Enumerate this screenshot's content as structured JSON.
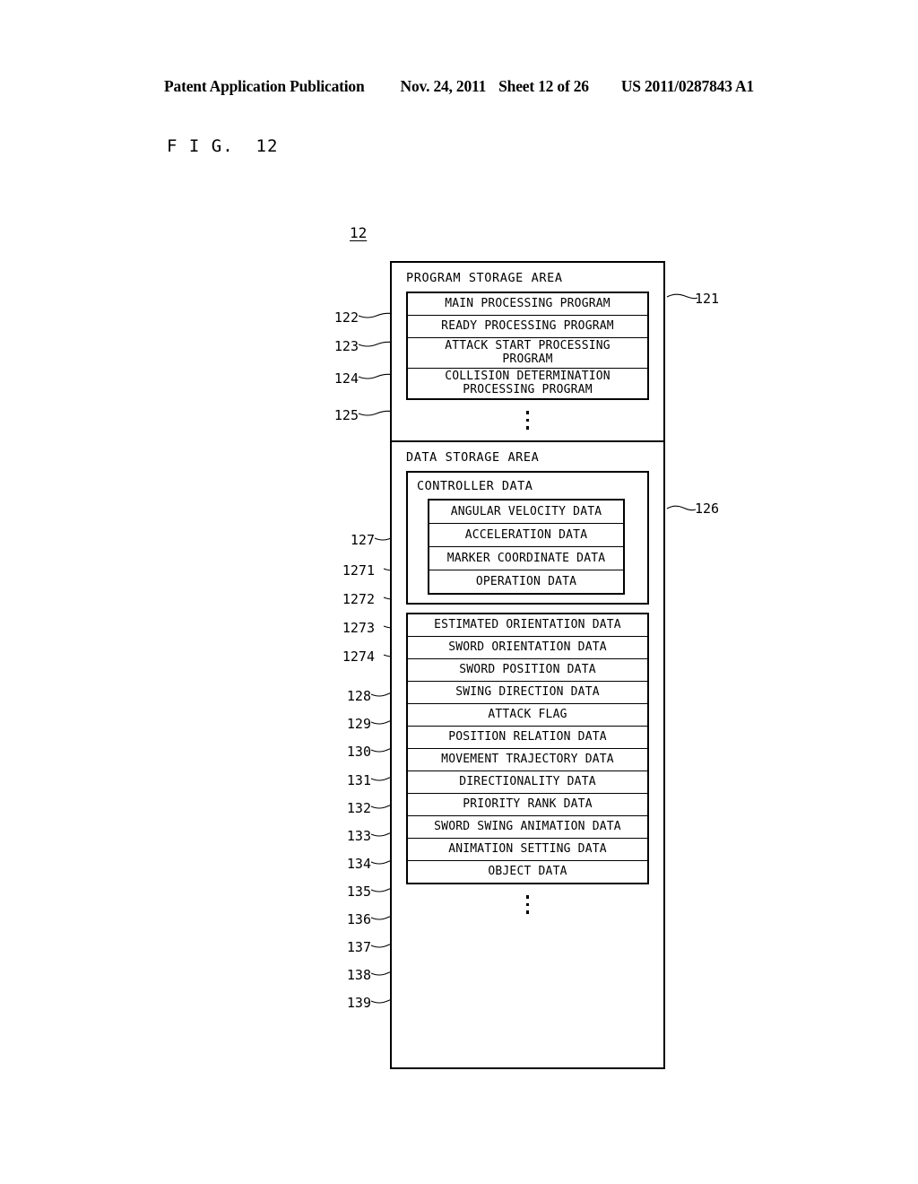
{
  "header": {
    "publication": "Patent Application Publication",
    "date": "Nov. 24, 2011",
    "sheet": "Sheet 12 of 26",
    "patent_number": "US 2011/0287843 A1"
  },
  "figure": {
    "caption": "F I G.  12",
    "top_ref": "12"
  },
  "diagram": {
    "program_area": {
      "title": "PROGRAM STORAGE AREA",
      "ref": "121",
      "items": [
        {
          "ref": "122",
          "label": "MAIN PROCESSING PROGRAM"
        },
        {
          "ref": "123",
          "label": "READY PROCESSING PROGRAM"
        },
        {
          "ref": "124",
          "label_line1": "ATTACK START PROCESSING",
          "label_line2": "PROGRAM"
        },
        {
          "ref": "125",
          "label_line1": "COLLISION DETERMINATION",
          "label_line2": "PROCESSING PROGRAM"
        }
      ]
    },
    "data_area": {
      "title": "DATA STORAGE AREA",
      "ref": "126",
      "controller_data": {
        "ref": "127",
        "title": "CONTROLLER DATA",
        "items": [
          {
            "ref": "1271",
            "label": "ANGULAR VELOCITY DATA"
          },
          {
            "ref": "1272",
            "label": "ACCELERATION DATA"
          },
          {
            "ref": "1273",
            "label": "MARKER COORDINATE DATA"
          },
          {
            "ref": "1274",
            "label": "OPERATION DATA"
          }
        ]
      },
      "items": [
        {
          "ref": "128",
          "label": "ESTIMATED ORIENTATION DATA"
        },
        {
          "ref": "129",
          "label": "SWORD ORIENTATION DATA"
        },
        {
          "ref": "130",
          "label": "SWORD POSITION DATA"
        },
        {
          "ref": "131",
          "label": "SWING DIRECTION DATA"
        },
        {
          "ref": "132",
          "label": "ATTACK FLAG"
        },
        {
          "ref": "133",
          "label": "POSITION RELATION DATA"
        },
        {
          "ref": "134",
          "label": "MOVEMENT TRAJECTORY DATA"
        },
        {
          "ref": "135",
          "label": "DIRECTIONALITY DATA"
        },
        {
          "ref": "136",
          "label": "PRIORITY RANK DATA"
        },
        {
          "ref": "137",
          "label": "SWORD SWING ANIMATION DATA"
        },
        {
          "ref": "138",
          "label": "ANIMATION SETTING DATA"
        },
        {
          "ref": "139",
          "label": "OBJECT DATA"
        }
      ]
    }
  }
}
